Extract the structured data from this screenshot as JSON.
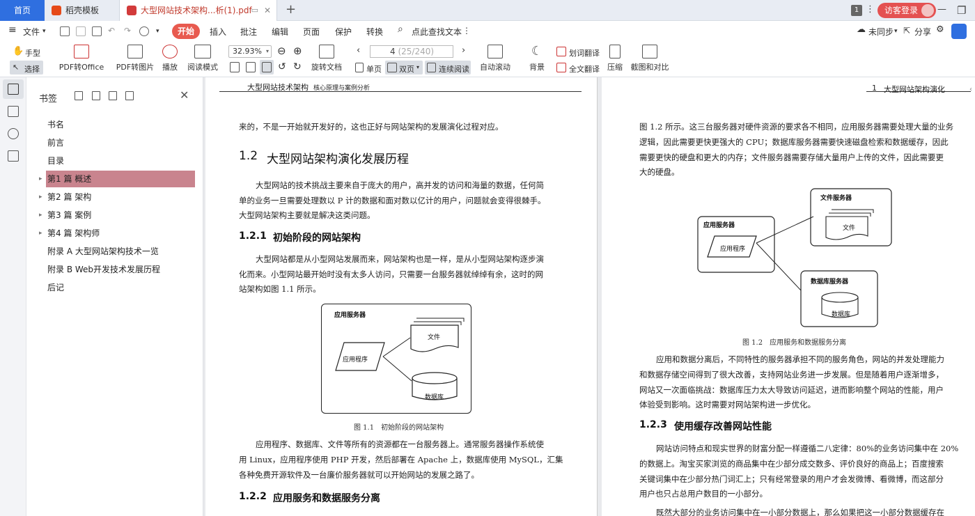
{
  "tabs": {
    "home": "首页",
    "template": "稻壳模板",
    "pdf": "大型网站技术架构...析(1).pdf",
    "window_count": "1",
    "guest_login": "访客登录"
  },
  "menu": {
    "file": "文件",
    "start": "开始",
    "insert": "插入",
    "annotate": "批注",
    "edit": "编辑",
    "page": "页面",
    "protect": "保护",
    "convert": "转换",
    "search": "点此查找文本",
    "sync": "未同步",
    "share": "分享"
  },
  "toolbar": {
    "hand": "手型",
    "select": "选择",
    "pdf_to_office": "PDF转Office",
    "pdf_to_image": "PDF转图片",
    "play": "播放",
    "read_mode": "阅读模式",
    "zoom": "32.93%",
    "rotate": "旋转文档",
    "page_current": "4",
    "page_total": "(25/240)",
    "single": "单页",
    "double": "双页",
    "continuous": "连续阅读",
    "auto_scroll": "自动滚动",
    "background": "背景",
    "word_translate": "划词翻译",
    "full_translate": "全文翻译",
    "compress": "压缩",
    "screenshot_compare": "截图和对比"
  },
  "bookmarks": {
    "title": "书签",
    "items": [
      {
        "label": "书名",
        "expandable": false
      },
      {
        "label": "前言",
        "expandable": false
      },
      {
        "label": "目录",
        "expandable": false
      },
      {
        "label": "第1 篇 概述",
        "expandable": true,
        "selected": true
      },
      {
        "label": "第2 篇 架构",
        "expandable": true
      },
      {
        "label": "第3 篇 案例",
        "expandable": true
      },
      {
        "label": "第4 篇 架构师",
        "expandable": true
      },
      {
        "label": "附录 A 大型网站架构技术一览",
        "expandable": false
      },
      {
        "label": "附录 B Web开发技术发展历程",
        "expandable": false
      },
      {
        "label": "后记",
        "expandable": false
      }
    ]
  },
  "left_page": {
    "header_title": "大型网站技术架构",
    "header_sub": "核心原理与案例分析",
    "p0": "来的，不是一开始就开发好的，这也正好与网站架构的发展演化过程对应。",
    "h_num": "1.2",
    "h_text": "大型网站架构演化发展历程",
    "p1_l1": "大型网站的技术挑战主要来自于庞大的用户，高并发的访问和海量的数据，任何简",
    "p1_l2": "单的业务一旦需要处理数以 P 计的数据和面对数以亿计的用户，问题就会变得很棘手。",
    "p1_l3": "大型网站架构主要就是解决这类问题。",
    "h3a_num": "1.2.1",
    "h3a_text": "初始阶段的网站架构",
    "p2_l1": "大型网站都是从小型网站发展而来，网站架构也是一样，是从小型网站架构逐步演",
    "p2_l2": "化而来。小型网站最开始时没有太多人访问，只需要一台服务器就绰绰有余，这时的网",
    "p2_l3": "站架构如图 1.1 所示。",
    "fig_server": "应用服务器",
    "fig_app": "应用程序",
    "fig_file": "文件",
    "fig_db": "数据库",
    "caption": "图 1.1　初始阶段的网站架构",
    "p3_l1": "应用程序、数据库、文件等所有的资源都在一台服务器上。通常服务器操作系统使",
    "p3_l2": "用 Linux，应用程序使用 PHP 开发，然后部署在 Apache 上，数据库使用 MySQL，汇集",
    "p3_l3": "各种免费开源软件及一台廉价服务器就可以开始网站的发展之路了。",
    "h3b_num": "1.2.2",
    "h3b_text": "应用服务和数据服务分离"
  },
  "right_page": {
    "header_num": "1",
    "header_title": "大型网站架构演化",
    "p0_l1": "图 1.2 所示。这三台服务器对硬件资源的要求各不相同，应用服务器需要处理大量的业务",
    "p0_l2": "逻辑，因此需要更快更强大的 CPU；数据库服务器需要快速磁盘检索和数据缓存，因此",
    "p0_l3": "需要更快的硬盘和更大的内存；文件服务器需要存储大量用户上传的文件，因此需要更",
    "p0_l4": "大的硬盘。",
    "fig_app_server": "应用服务器",
    "fig_app": "应用程序",
    "fig_file_server": "文件服务器",
    "fig_file": "文件",
    "fig_db_server": "数据库服务器",
    "fig_db": "数据库",
    "caption": "图 1.2　应用服务和数据服务分离",
    "p1_l1": "应用和数据分离后，不同特性的服务器承担不同的服务角色，网站的并发处理能力",
    "p1_l2": "和数据存储空间得到了很大改善，支持网站业务进一步发展。但是随着用户逐渐增多，",
    "p1_l3": "网站又一次面临挑战：数据库压力太大导致访问延迟，进而影响整个网站的性能，用户",
    "p1_l4": "体验受到影响。这时需要对网站架构进一步优化。",
    "h3_num": "1.2.3",
    "h3_text": "使用缓存改善网站性能",
    "p2_l1": "网站访问特点和现实世界的财富分配一样遵循二八定律：80%的业务访问集中在 20%",
    "p2_l2": "的数据上。淘宝买家浏览的商品集中在少部分成交数多、评价良好的商品上；百度搜索",
    "p2_l3": "关键词集中在少部分热门词汇上；只有经常登录的用户才会发微博、看微博，而这部分",
    "p2_l4": "用户也只占总用户数目的一小部分。",
    "p3_l1": "既然大部分的业务访问集中在一小部分数据上，那么如果把这一小部分数据缓存在"
  },
  "colors": {
    "accent": "#2f6fe0",
    "start_button": "#e85a4f",
    "bookmark_selected": "#c9848e"
  }
}
